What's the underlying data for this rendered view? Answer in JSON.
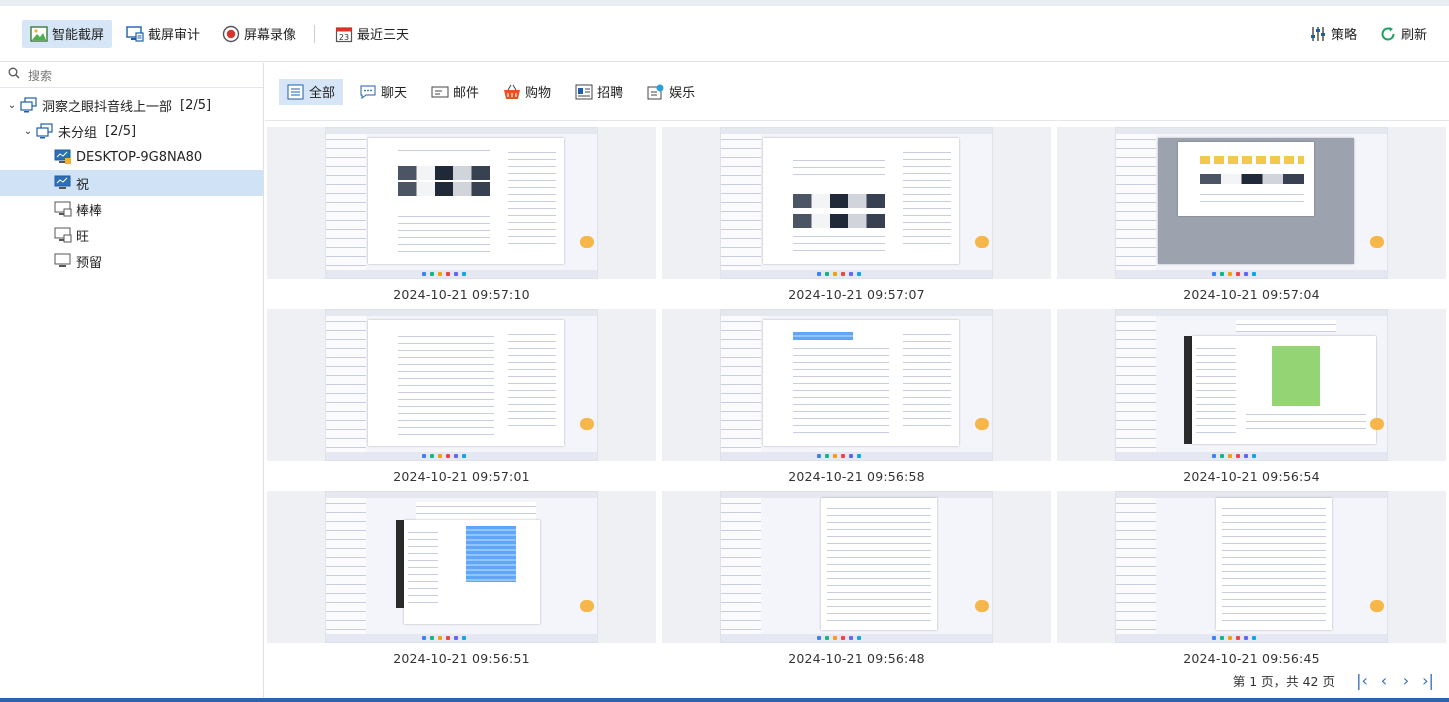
{
  "toolbar": {
    "smart_capture": "智能截屏",
    "capture_audit": "截屏审计",
    "screen_record": "屏幕录像",
    "calendar_day": "23",
    "recent_three_days": "最近三天",
    "policy": "策略",
    "refresh": "刷新"
  },
  "sidebar": {
    "search_placeholder": "搜索",
    "root": {
      "label": "洞察之眼抖音线上一部",
      "count": "[2/5]"
    },
    "group": {
      "label": "未分组",
      "count": "[2/5]"
    },
    "devices": [
      {
        "label": "DESKTOP-9G8NA80",
        "status": "online-warning"
      },
      {
        "label": "祝",
        "status": "online",
        "selected": true
      },
      {
        "label": "棒棒",
        "status": "offline"
      },
      {
        "label": "旺",
        "status": "offline"
      },
      {
        "label": "预留",
        "status": "offline"
      }
    ]
  },
  "categories": [
    "全部",
    "聊天",
    "邮件",
    "购物",
    "招聘",
    "娱乐"
  ],
  "screenshots": [
    {
      "time": "2024-10-21 09:57:10",
      "kind": "doc-images"
    },
    {
      "time": "2024-10-21 09:57:07",
      "kind": "doc-images-title"
    },
    {
      "time": "2024-10-21 09:57:04",
      "kind": "file-explorer"
    },
    {
      "time": "2024-10-21 09:57:01",
      "kind": "doc-text"
    },
    {
      "time": "2024-10-21 09:56:58",
      "kind": "doc-highlight"
    },
    {
      "time": "2024-10-21 09:56:54",
      "kind": "chat-green"
    },
    {
      "time": "2024-10-21 09:56:51",
      "kind": "chat-blue"
    },
    {
      "time": "2024-10-21 09:56:48",
      "kind": "long-doc"
    },
    {
      "time": "2024-10-21 09:56:45",
      "kind": "long-doc"
    }
  ],
  "pager": {
    "text": "第 1 页，共 42 页"
  },
  "colors": {
    "accent": "#2b65a7",
    "active_bg": "#d6e6f7",
    "selected_row": "#cfe2f6"
  }
}
